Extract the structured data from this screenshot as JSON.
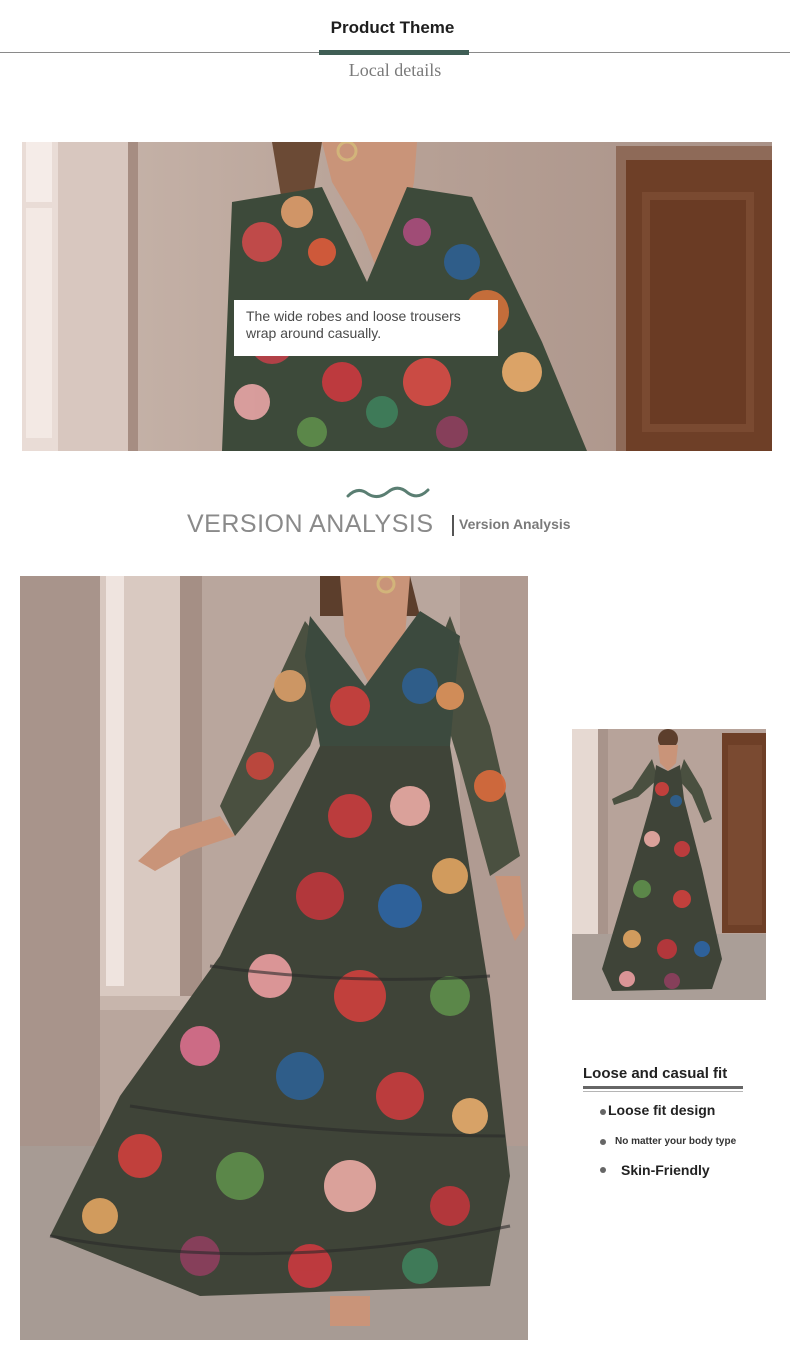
{
  "header": {
    "tab_title": "Product Theme",
    "subtitle": "Local details"
  },
  "detail_photo": {
    "caption": "The wide robes and loose trousers wrap around casually."
  },
  "version_analysis": {
    "title": "VERSION ANALYSIS",
    "label": "Version Analysis"
  },
  "features": {
    "title": "Loose and casual fit",
    "items": [
      "Loose fit design",
      "No matter your body type",
      "Skin-Friendly"
    ]
  },
  "colors": {
    "accent": "#3f5e55",
    "wall": "#b5a49a",
    "door": "#6e3f27"
  }
}
